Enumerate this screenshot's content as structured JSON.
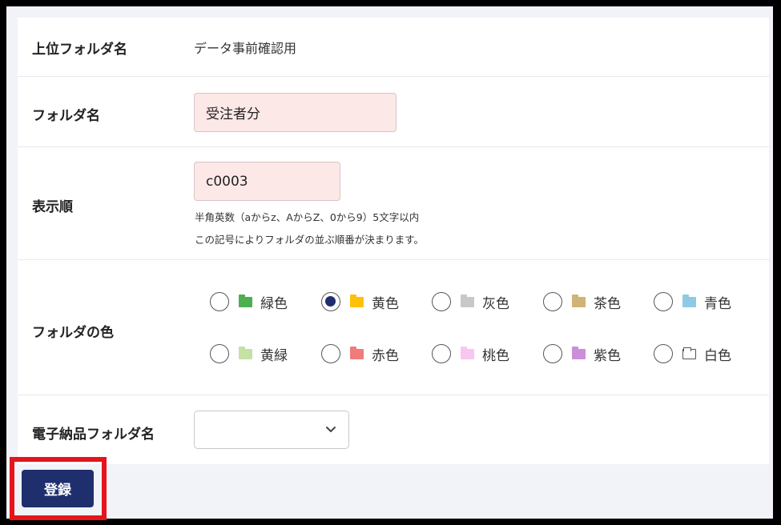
{
  "form": {
    "parent_folder": {
      "label": "上位フォルダ名",
      "value": "データ事前確認用"
    },
    "folder_name": {
      "label": "フォルダ名",
      "value": "受注者分"
    },
    "display_order": {
      "label": "表示順",
      "value": "c0003",
      "hint1": "半角英数（aからz、AからZ、0から9）5文字以内",
      "hint2": "この記号によりフォルダの並ぶ順番が決まります。"
    },
    "folder_color": {
      "label": "フォルダの色",
      "selected": "黄色",
      "options": [
        {
          "label": "緑色",
          "color": "#4caf50",
          "checked": false
        },
        {
          "label": "黄色",
          "color": "#ffc107",
          "checked": true
        },
        {
          "label": "灰色",
          "color": "#c8c8c8",
          "checked": false
        },
        {
          "label": "茶色",
          "color": "#d1b277",
          "checked": false
        },
        {
          "label": "青色",
          "color": "#8ecae6",
          "checked": false
        },
        {
          "label": "黄緑",
          "color": "#c5e1a5",
          "checked": false
        },
        {
          "label": "赤色",
          "color": "#f07b7b",
          "checked": false
        },
        {
          "label": "桃色",
          "color": "#f8c6ef",
          "checked": false
        },
        {
          "label": "紫色",
          "color": "#cc8ed9",
          "checked": false
        },
        {
          "label": "白色",
          "color": "#ffffff",
          "checked": false
        }
      ]
    },
    "electronic_folder": {
      "label": "電子納品フォルダ名",
      "value": ""
    },
    "submit_label": "登録"
  },
  "colors": {
    "primary": "#1f2f6e",
    "input_error_bg": "#fde8e8",
    "highlight": "#e4151b"
  }
}
